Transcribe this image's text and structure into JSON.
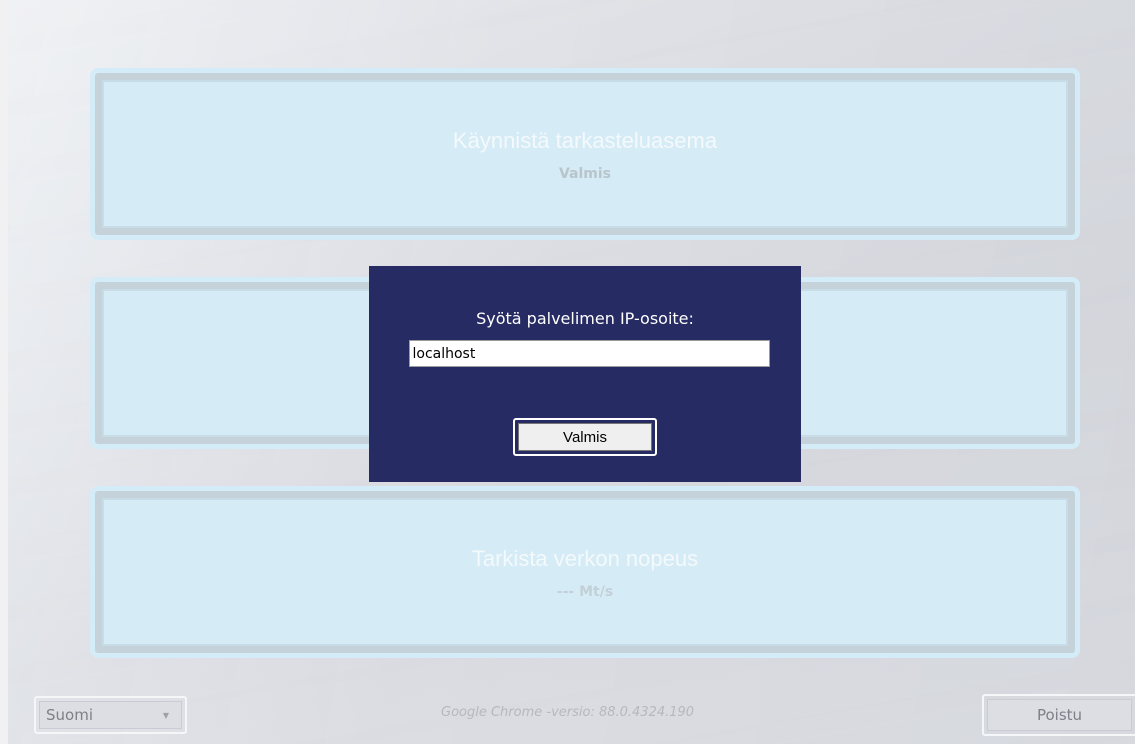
{
  "tiles": [
    {
      "title": "Käynnistä tarkasteluasema",
      "status": "Valmis"
    },
    {
      "title": "",
      "status": ""
    },
    {
      "title": "Tarkista verkon nopeus",
      "status": "--- Mt/s"
    }
  ],
  "dialog": {
    "prompt": "Syötä palvelimen IP-osoite:",
    "input_value": "localhost",
    "button_label": "Valmis"
  },
  "footer": {
    "language_selected": "Suomi",
    "version_text": "Google Chrome -versio:  88.0.4324.190",
    "quit_label": "Poistu"
  },
  "colors": {
    "dialog_bg": "#272b64",
    "tile_bg": "#d5ebf6",
    "tile_border": "#d3ecf7"
  },
  "icons": {
    "language_dropdown": "chevron-down-icon"
  }
}
